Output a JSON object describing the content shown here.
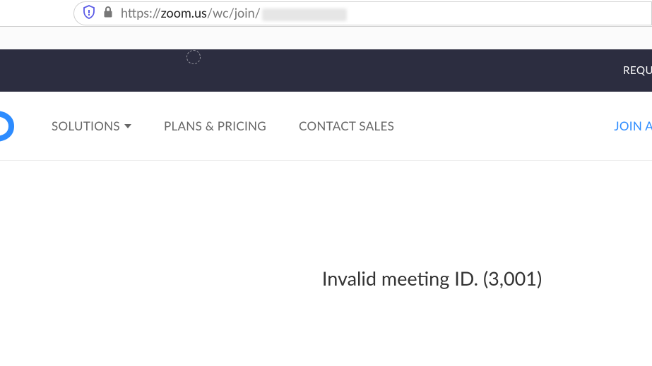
{
  "address_bar": {
    "url_prefix": "https://",
    "url_host": "zoom.us",
    "url_path": "/wc/join/"
  },
  "dark_bar": {
    "request_label": "REQU"
  },
  "nav": {
    "solutions_label": "SOLUTIONS",
    "pricing_label": "PLANS & PRICING",
    "contact_label": "CONTACT SALES",
    "join_label": "JOIN A"
  },
  "error": {
    "message": "Invalid meeting ID. (3,001)"
  }
}
